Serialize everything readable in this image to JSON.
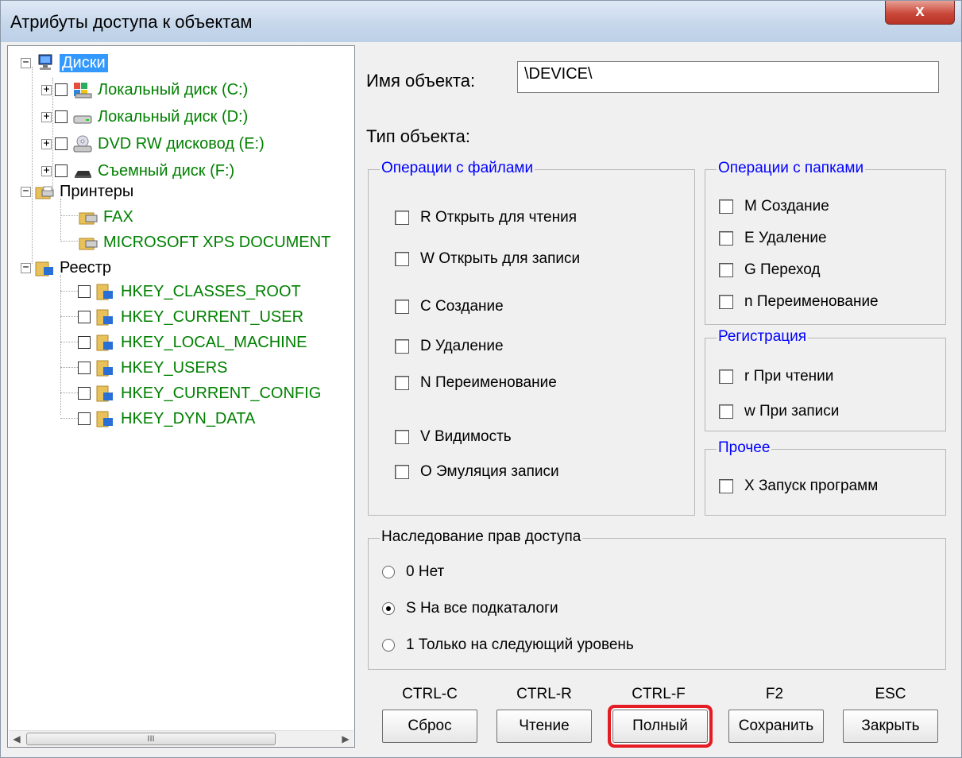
{
  "window": {
    "title": "Атрибуты доступа к объектам",
    "close_label": "x"
  },
  "tree": {
    "disks": {
      "label": "Диски",
      "items": [
        "Локальный диск (C:)",
        "Локальный диск (D:)",
        "DVD RW дисковод (E:)",
        "Съемный диск (F:)"
      ]
    },
    "printers": {
      "label": "Принтеры",
      "items": [
        "FAX",
        "MICROSOFT XPS DOCUMENT"
      ]
    },
    "registry": {
      "label": "Реестр",
      "items": [
        "HKEY_CLASSES_ROOT",
        "HKEY_CURRENT_USER",
        "HKEY_LOCAL_MACHINE",
        "HKEY_USERS",
        "HKEY_CURRENT_CONFIG",
        "HKEY_DYN_DATA"
      ]
    },
    "scroll_thumb_label": "III"
  },
  "object": {
    "name_label": "Имя объекта:",
    "name_value": "\\DEVICE\\",
    "type_label": "Тип объекта:"
  },
  "file_ops": {
    "title": "Операции с файлами",
    "items": [
      "R Открыть для чтения",
      "W Открыть для записи",
      "C Создание",
      "D Удаление",
      "N Переименование",
      "V Видимость",
      "O Эмуляция записи"
    ]
  },
  "folder_ops": {
    "title": "Операции с папками",
    "items": [
      "M Создание",
      "E Удаление",
      "G Переход",
      "n Переименование"
    ]
  },
  "registration": {
    "title": "Регистрация",
    "items": [
      "r При чтении",
      "w При записи"
    ]
  },
  "other": {
    "title": "Прочее",
    "items": [
      "X Запуск программ"
    ]
  },
  "inheritance": {
    "title": "Наследование прав доступа",
    "options": [
      "0 Нет",
      "S На все подкаталоги",
      "1 Только на следующий уровень"
    ],
    "selected": "S На все подкаталоги"
  },
  "buttons": [
    {
      "shortcut": "CTRL-C",
      "label": "Сброс"
    },
    {
      "shortcut": "CTRL-R",
      "label": "Чтение"
    },
    {
      "shortcut": "CTRL-F",
      "label": "Полный"
    },
    {
      "shortcut": "F2",
      "label": "Сохранить"
    },
    {
      "shortcut": "ESC",
      "label": "Закрыть"
    }
  ]
}
